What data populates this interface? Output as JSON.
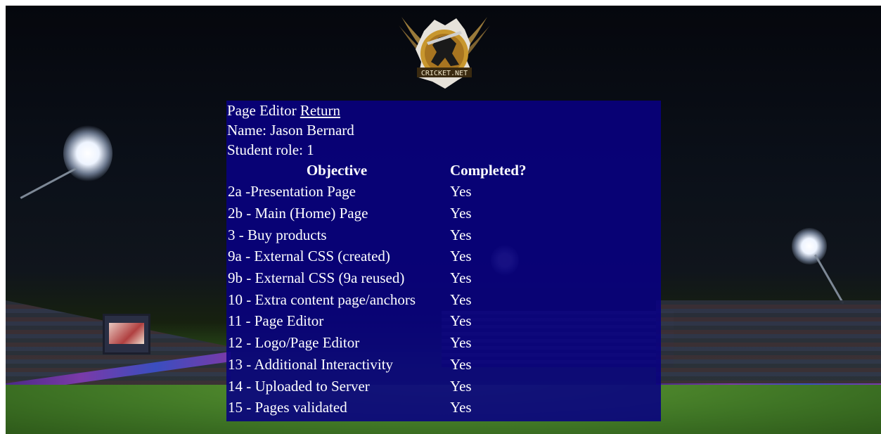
{
  "header": {
    "title": "Page Editor",
    "return_link": "Return"
  },
  "student": {
    "name_line": "Name: Jason Bernard",
    "role_line": "Student role: 1"
  },
  "logo": {
    "text": "CRICKET.NET"
  },
  "table": {
    "headers": [
      "Objective",
      "Completed?"
    ],
    "rows": [
      [
        "2a -Presentation Page",
        "Yes"
      ],
      [
        "2b - Main (Home) Page",
        "Yes"
      ],
      [
        "3 - Buy products",
        "Yes"
      ],
      [
        "9a - External CSS (created)",
        "Yes"
      ],
      [
        "9b - External CSS (9a reused)",
        "Yes"
      ],
      [
        "10 - Extra content page/anchors",
        "Yes"
      ],
      [
        "11 - Page Editor",
        "Yes"
      ],
      [
        "12 - Logo/Page Editor",
        "Yes"
      ],
      [
        "13 - Additional Interactivity",
        "Yes"
      ],
      [
        "14 - Uploaded to Server",
        "Yes"
      ],
      [
        "15 - Pages validated",
        "Yes"
      ]
    ]
  },
  "colors": {
    "panel": "#080082",
    "text": "#ffffff"
  }
}
